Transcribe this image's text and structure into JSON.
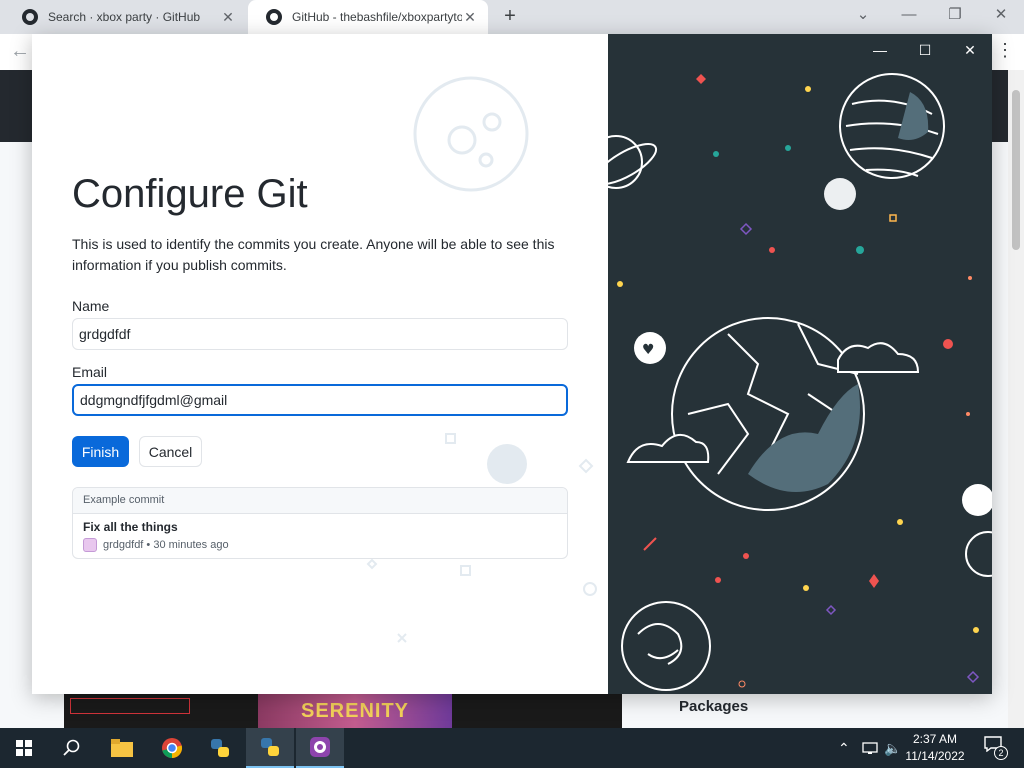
{
  "browser": {
    "tabs": [
      {
        "title": "Search · xbox party · GitHub",
        "active": false
      },
      {
        "title": "GitHub - thebashfile/xboxpartyto",
        "active": true
      }
    ],
    "new_tab": "+",
    "close": "✕",
    "minimize": "—",
    "restore": "❐",
    "back": "←",
    "menu": "⋮",
    "dropdown": "⌄"
  },
  "dialog": {
    "title": "Configure Git",
    "description": "This is used to identify the commits you create. Anyone will be able to see this information if you publish commits.",
    "name_label": "Name",
    "name_value": "grdgdfdf",
    "email_label": "Email",
    "email_value": "ddgmgndfjfgdml@gmail",
    "finish_label": "Finish",
    "cancel_label": "Cancel",
    "example": {
      "header": "Example commit",
      "message": "Fix all the things",
      "author": "grdgdfdf",
      "time": "30 minutes ago"
    },
    "controls": {
      "minimize": "—",
      "maximize": "☐",
      "close": "✕"
    }
  },
  "background": {
    "banner_text": "SERENITY",
    "packages_label": "Packages"
  },
  "taskbar": {
    "time": "2:37 AM",
    "date": "11/14/2022",
    "notification_count": "2",
    "apps": [
      "start-icon",
      "search-icon",
      "file-explorer-icon",
      "chrome-icon",
      "python-icon",
      "python-active-icon",
      "github-desktop-icon"
    ]
  },
  "colors": {
    "accent": "#0969da",
    "illustration_bg": "#263238",
    "taskbar": "#1c2730"
  }
}
